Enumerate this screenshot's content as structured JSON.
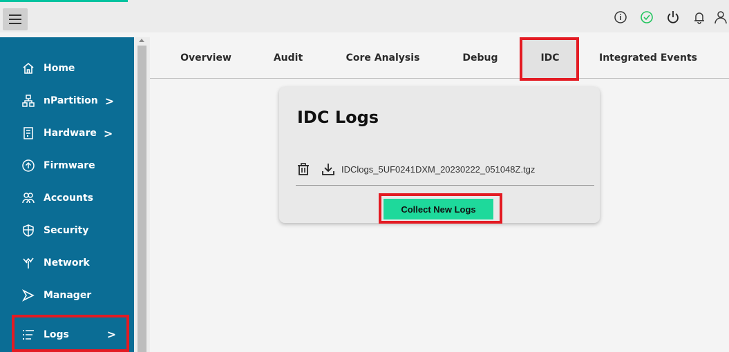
{
  "topbar": {
    "icons": [
      "info-icon",
      "status-ok-icon",
      "power-icon",
      "bell-icon",
      "user-icon"
    ],
    "status_color": "#22c55e",
    "accent_color": "#00c3a0"
  },
  "sidebar": {
    "bg_color": "#0b6d95",
    "items": [
      {
        "label": "Home",
        "icon": "home-icon",
        "chevron": ""
      },
      {
        "label": "nPartition",
        "icon": "partition-icon",
        "chevron": ">"
      },
      {
        "label": "Hardware",
        "icon": "hardware-icon",
        "chevron": ">"
      },
      {
        "label": "Firmware",
        "icon": "firmware-icon",
        "chevron": ""
      },
      {
        "label": "Accounts",
        "icon": "accounts-icon",
        "chevron": ""
      },
      {
        "label": "Security",
        "icon": "shield-icon",
        "chevron": ""
      },
      {
        "label": "Network",
        "icon": "network-icon",
        "chevron": ""
      },
      {
        "label": "Manager",
        "icon": "manager-icon",
        "chevron": ""
      },
      {
        "label": "Logs",
        "icon": "logs-icon",
        "chevron": ">"
      }
    ]
  },
  "tabs": [
    {
      "label": "Overview"
    },
    {
      "label": "Audit"
    },
    {
      "label": "Core Analysis"
    },
    {
      "label": "Debug"
    },
    {
      "label": "IDC"
    },
    {
      "label": "Integrated Events"
    }
  ],
  "card": {
    "title": "IDC Logs",
    "file_name": "IDClogs_5UF0241DXM_20230222_051048Z.tgz",
    "collect_label": "Collect New Logs",
    "button_color": "#1ed99b"
  },
  "highlight_color": "#e31b23"
}
